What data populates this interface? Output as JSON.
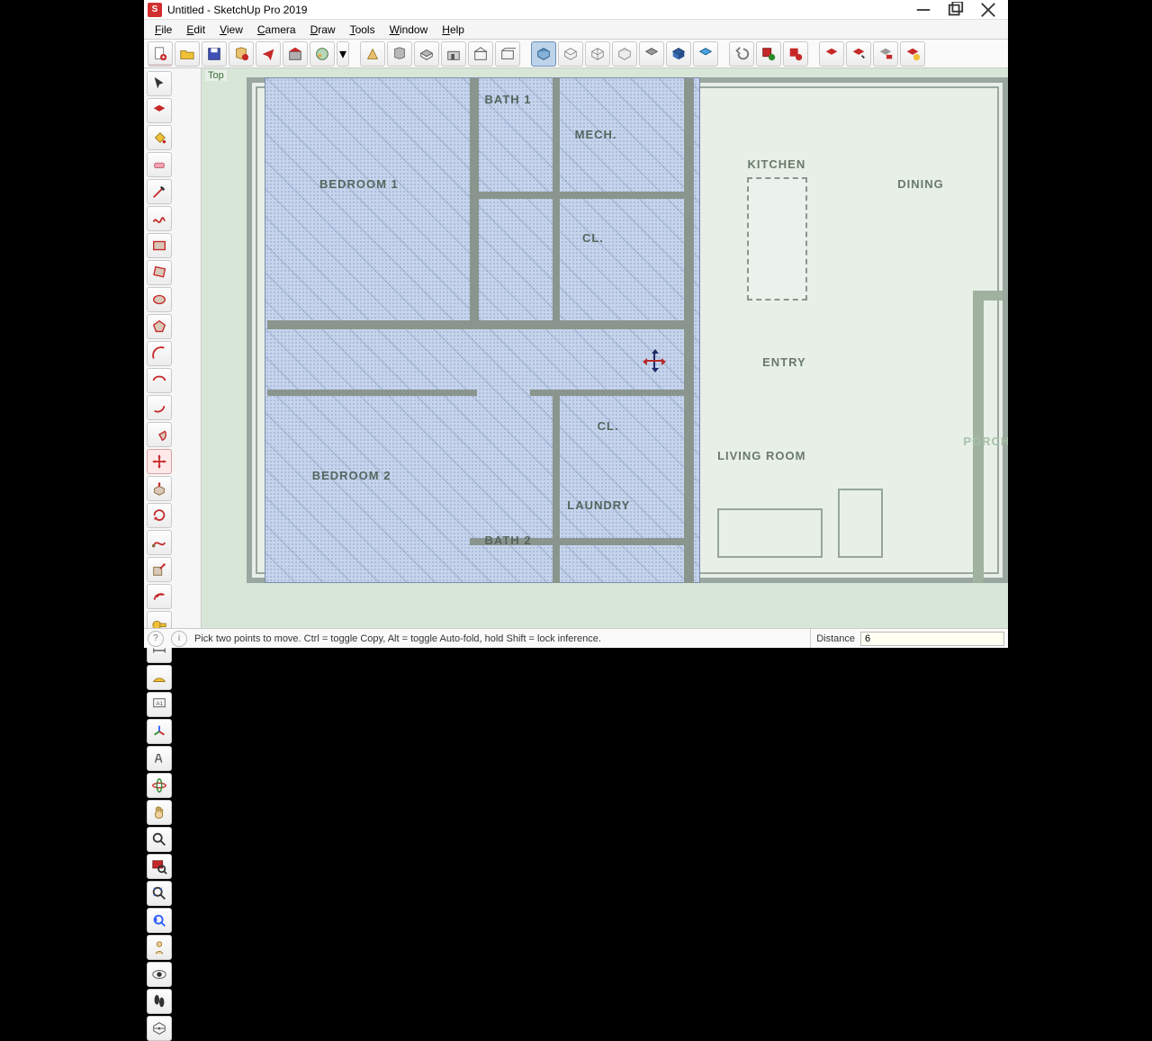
{
  "window": {
    "title": "Untitled - SketchUp Pro 2019"
  },
  "menu": {
    "items": [
      {
        "label": "File",
        "hot": "F"
      },
      {
        "label": "Edit",
        "hot": "E"
      },
      {
        "label": "View",
        "hot": "V"
      },
      {
        "label": "Camera",
        "hot": "C"
      },
      {
        "label": "Draw",
        "hot": "D"
      },
      {
        "label": "Tools",
        "hot": "T"
      },
      {
        "label": "Window",
        "hot": "W"
      },
      {
        "label": "Help",
        "hot": "H"
      }
    ]
  },
  "view_label": "Top",
  "rooms": {
    "bath1": "BATH 1",
    "mech": "MECH.",
    "bedroom1": "BEDROOM 1",
    "cl1": "CL.",
    "bedroom2": "BEDROOM 2",
    "cl2": "CL.",
    "laundry": "LAUNDRY",
    "bath2": "BATH 2",
    "kitchen": "KITCHEN",
    "dining": "DINING",
    "entry": "ENTRY",
    "living": "LIVING ROOM",
    "porch": "PORCH"
  },
  "status": {
    "hint": "Pick two points to move.  Ctrl = toggle Copy, Alt = toggle Auto-fold, hold Shift = lock inference.",
    "measure_label": "Distance",
    "measure_value": "6"
  }
}
